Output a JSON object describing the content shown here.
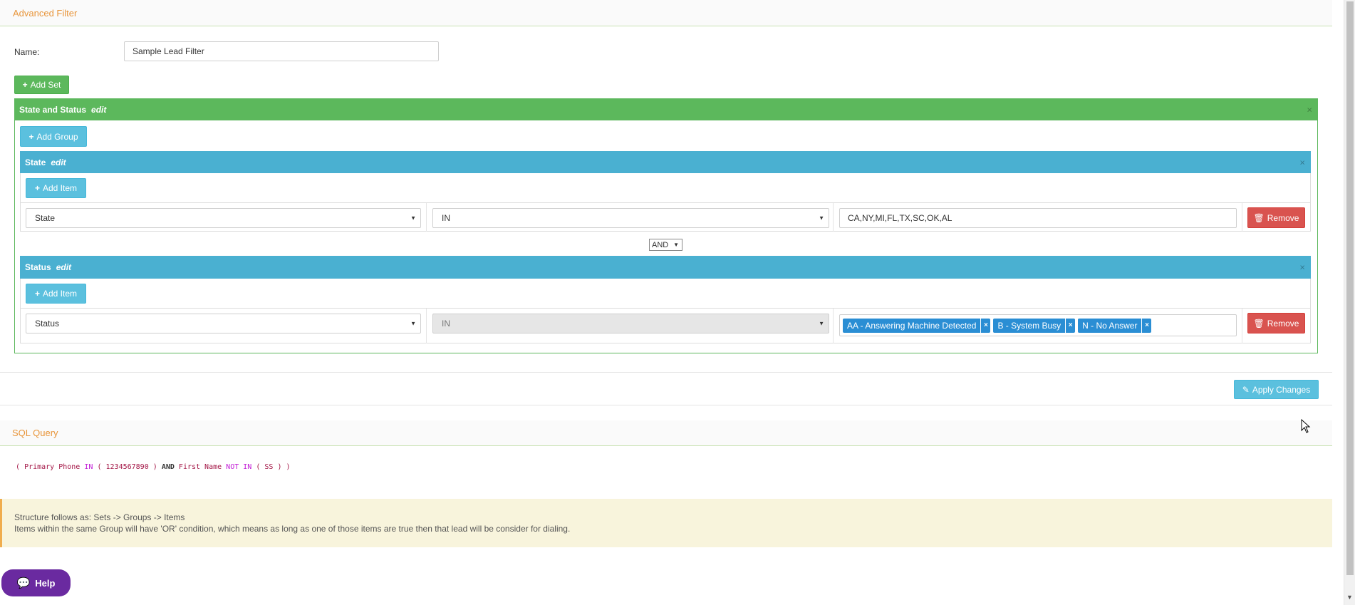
{
  "advanced_filter": {
    "title": "Advanced Filter",
    "name_label": "Name:",
    "name_value": "Sample Lead Filter",
    "add_set_label": "Add Set"
  },
  "set": {
    "title": "State and Status",
    "edit_label": "edit",
    "add_group_label": "Add Group",
    "close_glyph": "×"
  },
  "groups": [
    {
      "title": "State",
      "edit_label": "edit",
      "add_item_label": "Add Item",
      "field": "State",
      "operator": "IN",
      "value": "CA,NY,MI,FL,TX,SC,OK,AL",
      "remove_label": "Remove"
    },
    {
      "title": "Status",
      "edit_label": "edit",
      "add_item_label": "Add Item",
      "field": "Status",
      "operator": "IN",
      "tags": [
        "AA - Answering Machine Detected",
        "B - System Busy",
        "N - No Answer"
      ],
      "remove_label": "Remove"
    }
  ],
  "connector": "AND",
  "apply_changes_label": "Apply Changes",
  "sql_query": {
    "title": "SQL Query",
    "tokens": [
      "(",
      "Primary Phone",
      "IN",
      "(",
      "1234567890",
      ")",
      "AND",
      "First Name",
      "NOT IN",
      "(",
      "SS",
      ")",
      ")"
    ]
  },
  "note": {
    "line1": "Structure follows as: Sets -> Groups -> Items",
    "line2": "Items within the same Group will have 'OR' condition, which means as long as one of those items are true then that lead will be consider for dialing."
  },
  "help_label": "Help",
  "colors": {
    "accent_orange": "#e8953a",
    "set_green": "#5cb85c",
    "group_blue": "#4ab0d1",
    "remove_red": "#d9534f",
    "tag_blue": "#2a8ed4",
    "help_purple": "#6a2aa0"
  }
}
